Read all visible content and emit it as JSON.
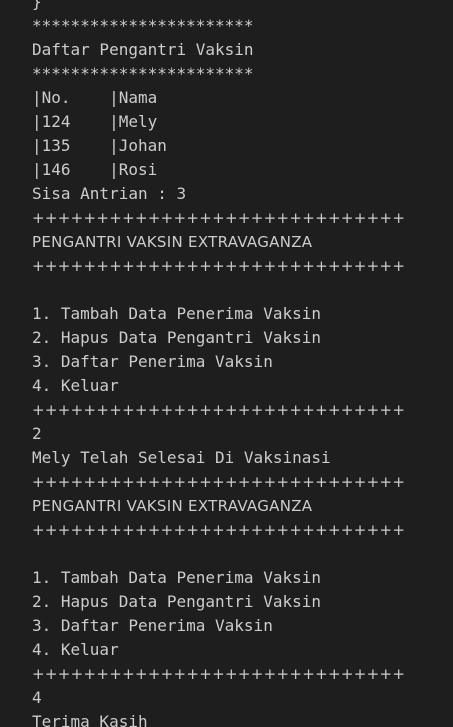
{
  "terminal": {
    "lines": [
      "}",
      "***********************",
      "Daftar Pengantri Vaksin",
      "***********************",
      "|No.    |Nama",
      "|124    |Mely",
      "|135    |Johan",
      "|146    |Rosi",
      "Sisa Antrian : 3",
      "+++++++++++++++++++++++++++++",
      "PENGANTRI VAKSIN EXTRAVAGANZA",
      "+++++++++++++++++++++++++++++",
      "",
      "1. Tambah Data Penerima Vaksin",
      "2. Hapus Data Pengantri Vaksin",
      "3. Daftar Penerima Vaksin",
      "4. Keluar",
      "+++++++++++++++++++++++++++++",
      "2",
      "Mely Telah Selesai Di Vaksinasi",
      "+++++++++++++++++++++++++++++",
      "PENGANTRI VAKSIN EXTRAVAGANZA",
      "+++++++++++++++++++++++++++++",
      "",
      "1. Tambah Data Penerima Vaksin",
      "2. Hapus Data Pengantri Vaksin",
      "3. Daftar Penerima Vaksin",
      "4. Keluar",
      "+++++++++++++++++++++++++++++",
      "4",
      "Terima Kasih"
    ]
  },
  "colors": {
    "background": "#1e1e1e",
    "text": "#cccccc"
  }
}
